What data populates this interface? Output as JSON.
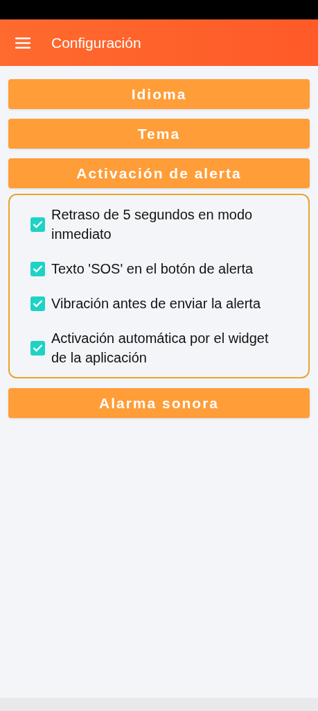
{
  "app_bar": {
    "title": "Configuración"
  },
  "sections": [
    {
      "label": "Idioma"
    },
    {
      "label": "Tema"
    },
    {
      "label": "Activación de alerta",
      "options": [
        {
          "label": "Retraso de 5 segundos en modo inmediato",
          "checked": true
        },
        {
          "label": "Texto 'SOS' en el botón de alerta",
          "checked": true
        },
        {
          "label": "Vibración antes de enviar la alerta",
          "checked": true
        },
        {
          "label": "Activación automática por el widget de la aplicación",
          "checked": true
        }
      ]
    },
    {
      "label": "Alarma sonora"
    }
  ]
}
